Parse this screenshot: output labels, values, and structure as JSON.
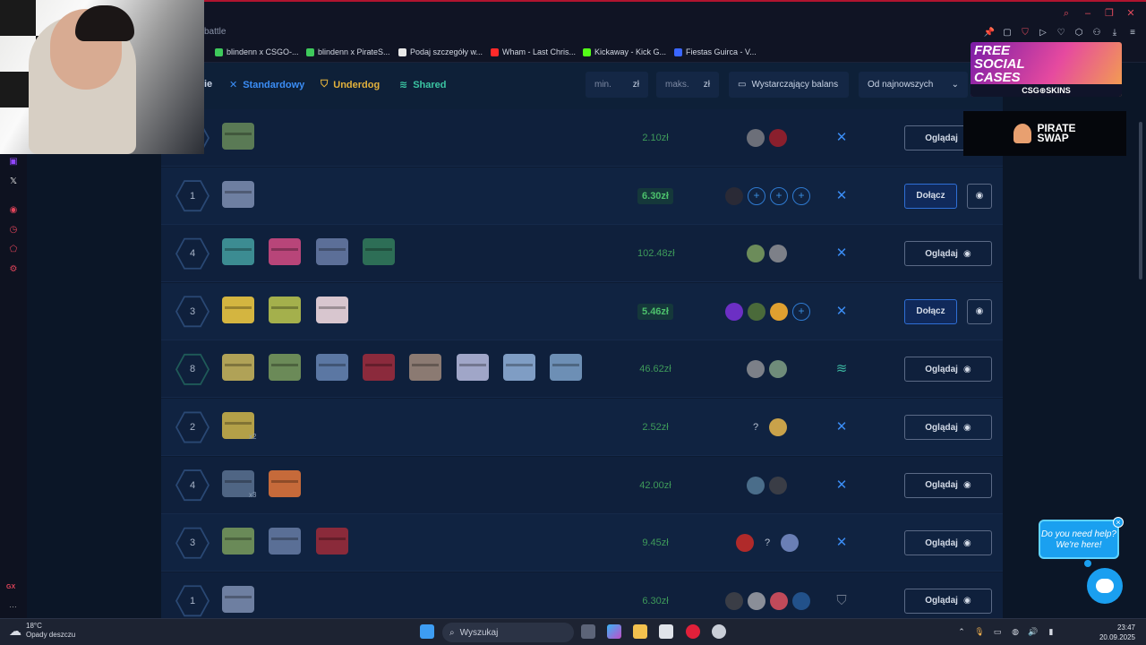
{
  "browser": {
    "tab_title": "battle",
    "window_controls": [
      "search-icon",
      "minimize-icon",
      "restore-icon",
      "close-icon"
    ],
    "toolbar_icons": [
      "pin-icon",
      "snapshot-icon",
      "shield-icon",
      "play-icon",
      "heart-icon",
      "cube-icon",
      "download-icon",
      "user-icon",
      "download-arrow-icon",
      "menu-icon"
    ]
  },
  "bookmarks": [
    {
      "label": "blindenn x CSGO-...",
      "color": "#3ec95b"
    },
    {
      "label": "blindenn x PirateS...",
      "color": "#3ec95b"
    },
    {
      "label": "Podaj szczegóły w...",
      "color": "#e8e8e8"
    },
    {
      "label": "Wham - Last Chris...",
      "color": "#ff2a2a"
    },
    {
      "label": "Kickaway - Kick G...",
      "color": "#53fc18"
    },
    {
      "label": "Fiestas Guirca - V...",
      "color": "#3a66ff"
    }
  ],
  "filters": {
    "partial_label": "ie",
    "standard": "Standardowy",
    "underdog": "Underdog",
    "shared": "Shared",
    "min_placeholder": "min.",
    "max_placeholder": "maks.",
    "currency": "zł",
    "balance": "Wystarczający balans",
    "sort": "Od najnowszych"
  },
  "rows": [
    {
      "players": "",
      "cases": [
        {
          "color": "#5a7a55"
        }
      ],
      "price": "2.10zł",
      "active": false,
      "avatars": [
        "#6c6f79",
        "#8a1f2d"
      ],
      "mode": "standard",
      "action": "Oglądaj"
    },
    {
      "players": "1",
      "cases": [
        {
          "color": "#6e7fa1"
        }
      ],
      "price": "6.30zł",
      "active": true,
      "avatars": [
        "#2a2a36",
        "+",
        "+",
        "+"
      ],
      "mode": "standard",
      "action": "Dołącz"
    },
    {
      "players": "4",
      "cases": [
        {
          "color": "#3c8c92"
        },
        {
          "color": "#b84579"
        },
        {
          "color": "#5c6f98"
        },
        {
          "color": "#2d6e56"
        }
      ],
      "price": "102.48zł",
      "active": false,
      "avatars": [
        "#6c8c5a",
        "#7d8088"
      ],
      "mode": "standard",
      "action": "Oglądaj"
    },
    {
      "players": "3",
      "cases": [
        {
          "color": "#d4b540"
        },
        {
          "color": "#a4b04c"
        },
        {
          "color": "#d8c6cf"
        }
      ],
      "price": "5.46zł",
      "active": true,
      "avatars": [
        "#6c2fc4",
        "#4a6a3a",
        "#e0a030",
        "+"
      ],
      "mode": "standard",
      "action": "Dołącz"
    },
    {
      "players": "8",
      "cases": [
        {
          "color": "#b0a257"
        },
        {
          "color": "#6b8a58"
        },
        {
          "color": "#5b77a3"
        },
        {
          "color": "#8b2a3c"
        },
        {
          "color": "#8b7a72"
        },
        {
          "color": "#a0a6c8"
        },
        {
          "color": "#7f9dc4"
        },
        {
          "color": "#6d8fb5"
        }
      ],
      "price": "46.62zł",
      "active": false,
      "avatars": [
        "#7c8088",
        "#6f8c7a"
      ],
      "mode": "shared",
      "action": "Oglądaj"
    },
    {
      "players": "2",
      "cases": [
        {
          "color": "#b3a048",
          "mult": "x2"
        }
      ],
      "price": "2.52zł",
      "active": false,
      "avatars": [
        "?",
        "#c9a24a"
      ],
      "mode": "standard",
      "action": "Oglądaj"
    },
    {
      "players": "4",
      "cases": [
        {
          "color": "#4f6584",
          "mult": "x3"
        },
        {
          "color": "#c66a3a"
        }
      ],
      "price": "42.00zł",
      "active": false,
      "avatars": [
        "#4a6d8a",
        "#3a3d46"
      ],
      "mode": "standard",
      "action": "Oglądaj"
    },
    {
      "players": "3",
      "cases": [
        {
          "color": "#6a8a58"
        },
        {
          "color": "#5a6f96"
        },
        {
          "color": "#8a2a3a"
        }
      ],
      "price": "9.45zł",
      "active": false,
      "avatars": [
        "#b02a2a",
        "?",
        "#6a7fb5"
      ],
      "mode": "standard",
      "action": "Oglądaj"
    },
    {
      "players": "1",
      "cases": [
        {
          "color": "#6e7fa1"
        }
      ],
      "price": "6.30zł",
      "active": false,
      "avatars": [
        "#3a3d46",
        "#8a8e98",
        "#c04a5a",
        "#22518a"
      ],
      "mode": "underdog",
      "action": "Oglądaj"
    }
  ],
  "ads": {
    "free_social_cases": "FREE SOCIAL CASES",
    "csgo_skins": "CSG⊕SKINS",
    "pirate_swap_line1": "PIRATE",
    "pirate_swap_line2": "SWAP"
  },
  "help": {
    "line1": "Do you need help?",
    "line2": "We're here!"
  },
  "taskbar": {
    "temp": "18°C",
    "weather": "Opady deszczu",
    "search": "Wyszukaj",
    "time": "23:47",
    "date": "20.09.2025"
  }
}
